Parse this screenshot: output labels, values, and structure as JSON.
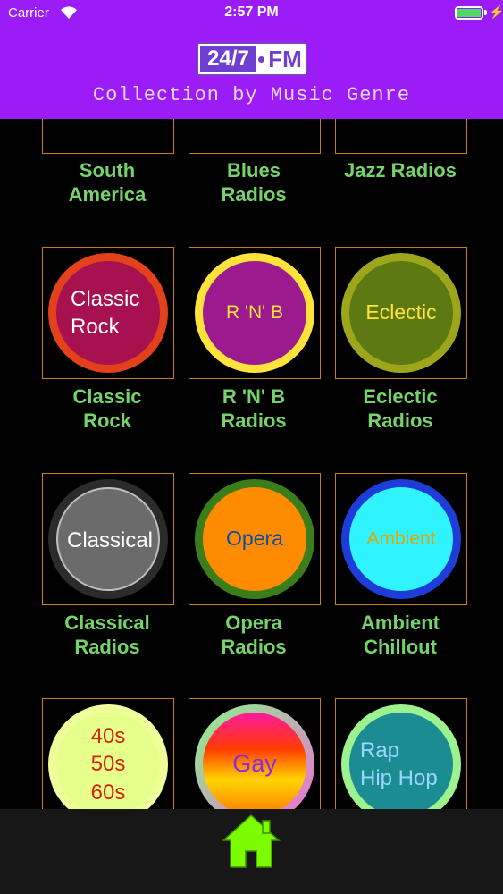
{
  "status_bar": {
    "carrier": "Carrier",
    "time": "2:57 PM"
  },
  "header": {
    "logo_left": "24/7",
    "logo_right": "FM",
    "subtitle": "Collection by Music Genre"
  },
  "genres": [
    {
      "caption_line1": "South",
      "caption_line2": "America",
      "disc_label": ""
    },
    {
      "caption_line1": "Blues",
      "caption_line2": "Radios",
      "disc_label": ""
    },
    {
      "caption_line1": "Jazz Radios",
      "caption_line2": "",
      "disc_label": ""
    },
    {
      "caption_line1": "Classic",
      "caption_line2": "Rock",
      "disc_label_1": "Classic",
      "disc_label_2": "Rock"
    },
    {
      "caption_line1": "R 'N' B",
      "caption_line2": "Radios",
      "disc_label": "R 'N' B"
    },
    {
      "caption_line1": "Eclectic",
      "caption_line2": "Radios",
      "disc_label": "Eclectic"
    },
    {
      "caption_line1": "Classical",
      "caption_line2": "Radios",
      "disc_label": "Classical"
    },
    {
      "caption_line1": "Opera",
      "caption_line2": "Radios",
      "disc_label": "Opera"
    },
    {
      "caption_line1": "Ambient",
      "caption_line2": "Chillout",
      "disc_label": "Ambient"
    },
    {
      "disc_label_1": "40s",
      "disc_label_2": "50s",
      "disc_label_3": "60s"
    },
    {
      "disc_label": "Gay"
    },
    {
      "disc_label_1": "Rap",
      "disc_label_2": "Hip Hop"
    }
  ],
  "colors": {
    "header_bg": "#9b1cf7",
    "caption": "#76d36b",
    "tile_border": "#c97f10",
    "home_icon": "#7cfc00"
  },
  "icons": {
    "home": "home-icon"
  }
}
